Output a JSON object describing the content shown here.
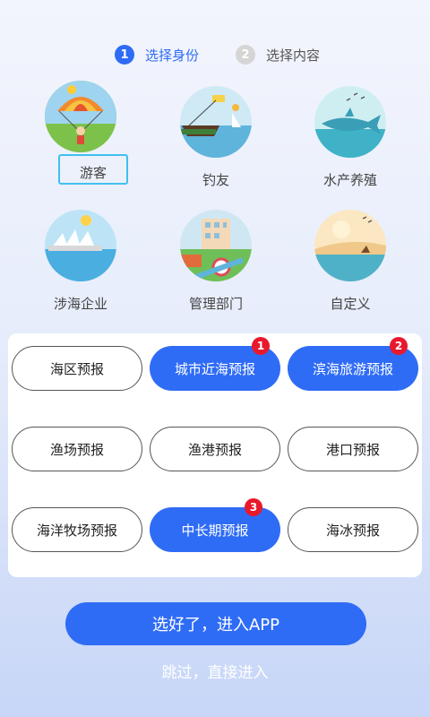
{
  "steps": [
    {
      "num": "1",
      "label": "选择身份"
    },
    {
      "num": "2",
      "label": "选择内容"
    }
  ],
  "identities": [
    {
      "name": "游客",
      "icon": "parachute-icon",
      "selected": true
    },
    {
      "name": "钓友",
      "icon": "fishing-boat-icon"
    },
    {
      "name": "水产养殖",
      "icon": "shark-icon"
    },
    {
      "name": "涉海企业",
      "icon": "opera-house-icon"
    },
    {
      "name": "管理部门",
      "icon": "city-building-icon"
    },
    {
      "name": "自定义",
      "icon": "sunset-beach-icon"
    }
  ],
  "forecasts": [
    {
      "label": "海区预报",
      "selected": false
    },
    {
      "label": "城市近海预报",
      "selected": true,
      "badge": "1"
    },
    {
      "label": "滨海旅游预报",
      "selected": true,
      "badge": "2"
    },
    {
      "label": "渔场预报",
      "selected": false
    },
    {
      "label": "渔港预报",
      "selected": false
    },
    {
      "label": "港口预报",
      "selected": false
    },
    {
      "label": "海洋牧场预报",
      "selected": false
    },
    {
      "label": "中长期预报",
      "selected": true,
      "badge": "3"
    },
    {
      "label": "海冰预报",
      "selected": false
    }
  ],
  "actions": {
    "enter_label": "选好了，进入APP",
    "skip_label": "跳过，直接进入"
  },
  "colors": {
    "accent": "#2f6cf6",
    "badge": "#e8192c",
    "selected_outline": "#3fc0ef"
  }
}
